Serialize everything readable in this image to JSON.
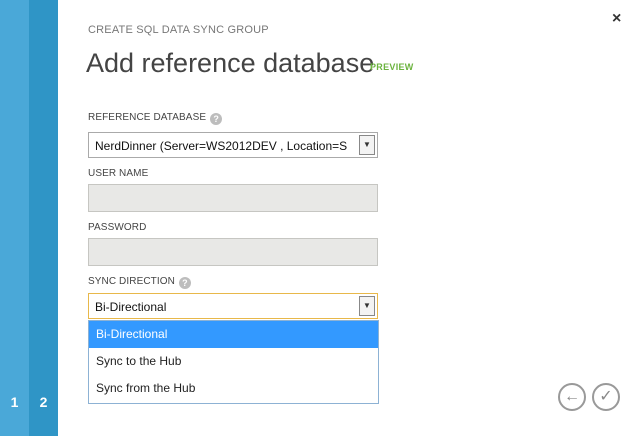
{
  "wizard": {
    "header": "CREATE SQL DATA SYNC GROUP",
    "title": "Add reference database",
    "preview_badge": "PREVIEW",
    "steps": [
      "1",
      "2"
    ],
    "close_glyph": "×"
  },
  "form": {
    "reference_database": {
      "label": "REFERENCE DATABASE",
      "help_glyph": "?",
      "value": "NerdDinner (Server=WS2012DEV , Location=S"
    },
    "user_name": {
      "label": "USER NAME",
      "value": ""
    },
    "password": {
      "label": "PASSWORD",
      "value": ""
    },
    "sync_direction": {
      "label": "SYNC DIRECTION",
      "help_glyph": "?",
      "value": "Bi-Directional",
      "options": [
        "Bi-Directional",
        "Sync to the Hub",
        "Sync from the Hub"
      ],
      "highlighted_option": "Bi-Directional"
    }
  },
  "footer": {
    "back_glyph": "←",
    "confirm_glyph": "✓"
  },
  "colors": {
    "rail_light": "#4aa8d8",
    "rail_dark": "#2f95c6",
    "preview_green": "#6bb33e",
    "highlight_blue": "#3399ff"
  }
}
